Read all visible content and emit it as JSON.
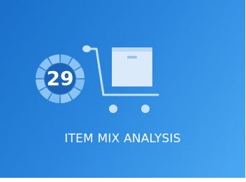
{
  "tile": {
    "label": "ITEM MIX ANALYSIS",
    "icon": "shopping-cart-icon",
    "badge": {
      "count": "29",
      "ring_color": "#9fd0f7",
      "center_color": "#1b63b8"
    },
    "background_start": "#1a6fc9",
    "background_end": "#4aa8f3"
  }
}
